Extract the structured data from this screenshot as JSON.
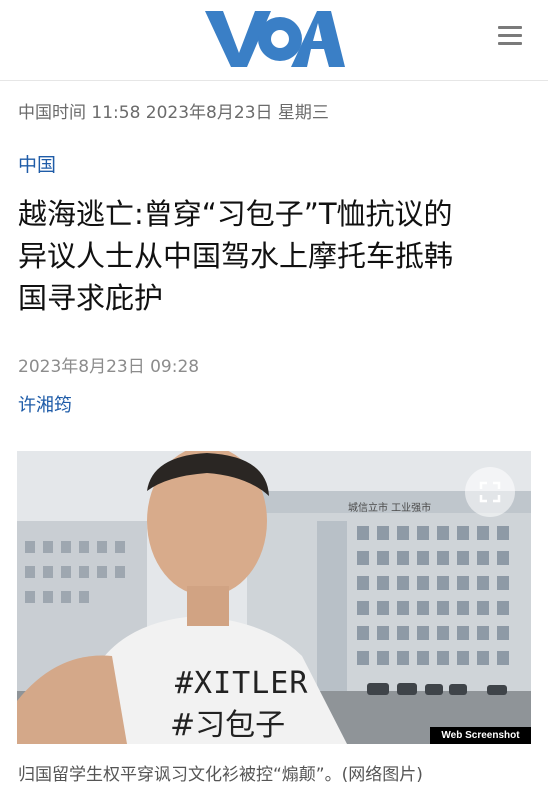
{
  "header": {
    "logo_text": "VOA",
    "menu_icon": "hamburger-menu-icon"
  },
  "timebar": "中国时间 11:58 2023年8月23日 星期三",
  "article": {
    "category": "中国",
    "headline_lines": [
      "越海逃亡:曾穿“习包子”T恤抗议的",
      "异议人士从中国驾水上摩托车抵韩",
      "国寻求庇护"
    ],
    "pubdate": "2023年8月23日 09:28",
    "author": "许湘筠"
  },
  "photo": {
    "shirt_line1": "#XITLER",
    "shirt_line2": "#习包子",
    "building_sign": "城信立市 工业强市",
    "watermark": "Web Screenshot",
    "expand_icon": "expand-icon",
    "caption": "归国留学生权平穿讽习文化衫被控“煽颠”。(网络图片)"
  },
  "colors": {
    "brand_blue": "#1f5ca8",
    "logo_blue": "#3a7fc6"
  }
}
